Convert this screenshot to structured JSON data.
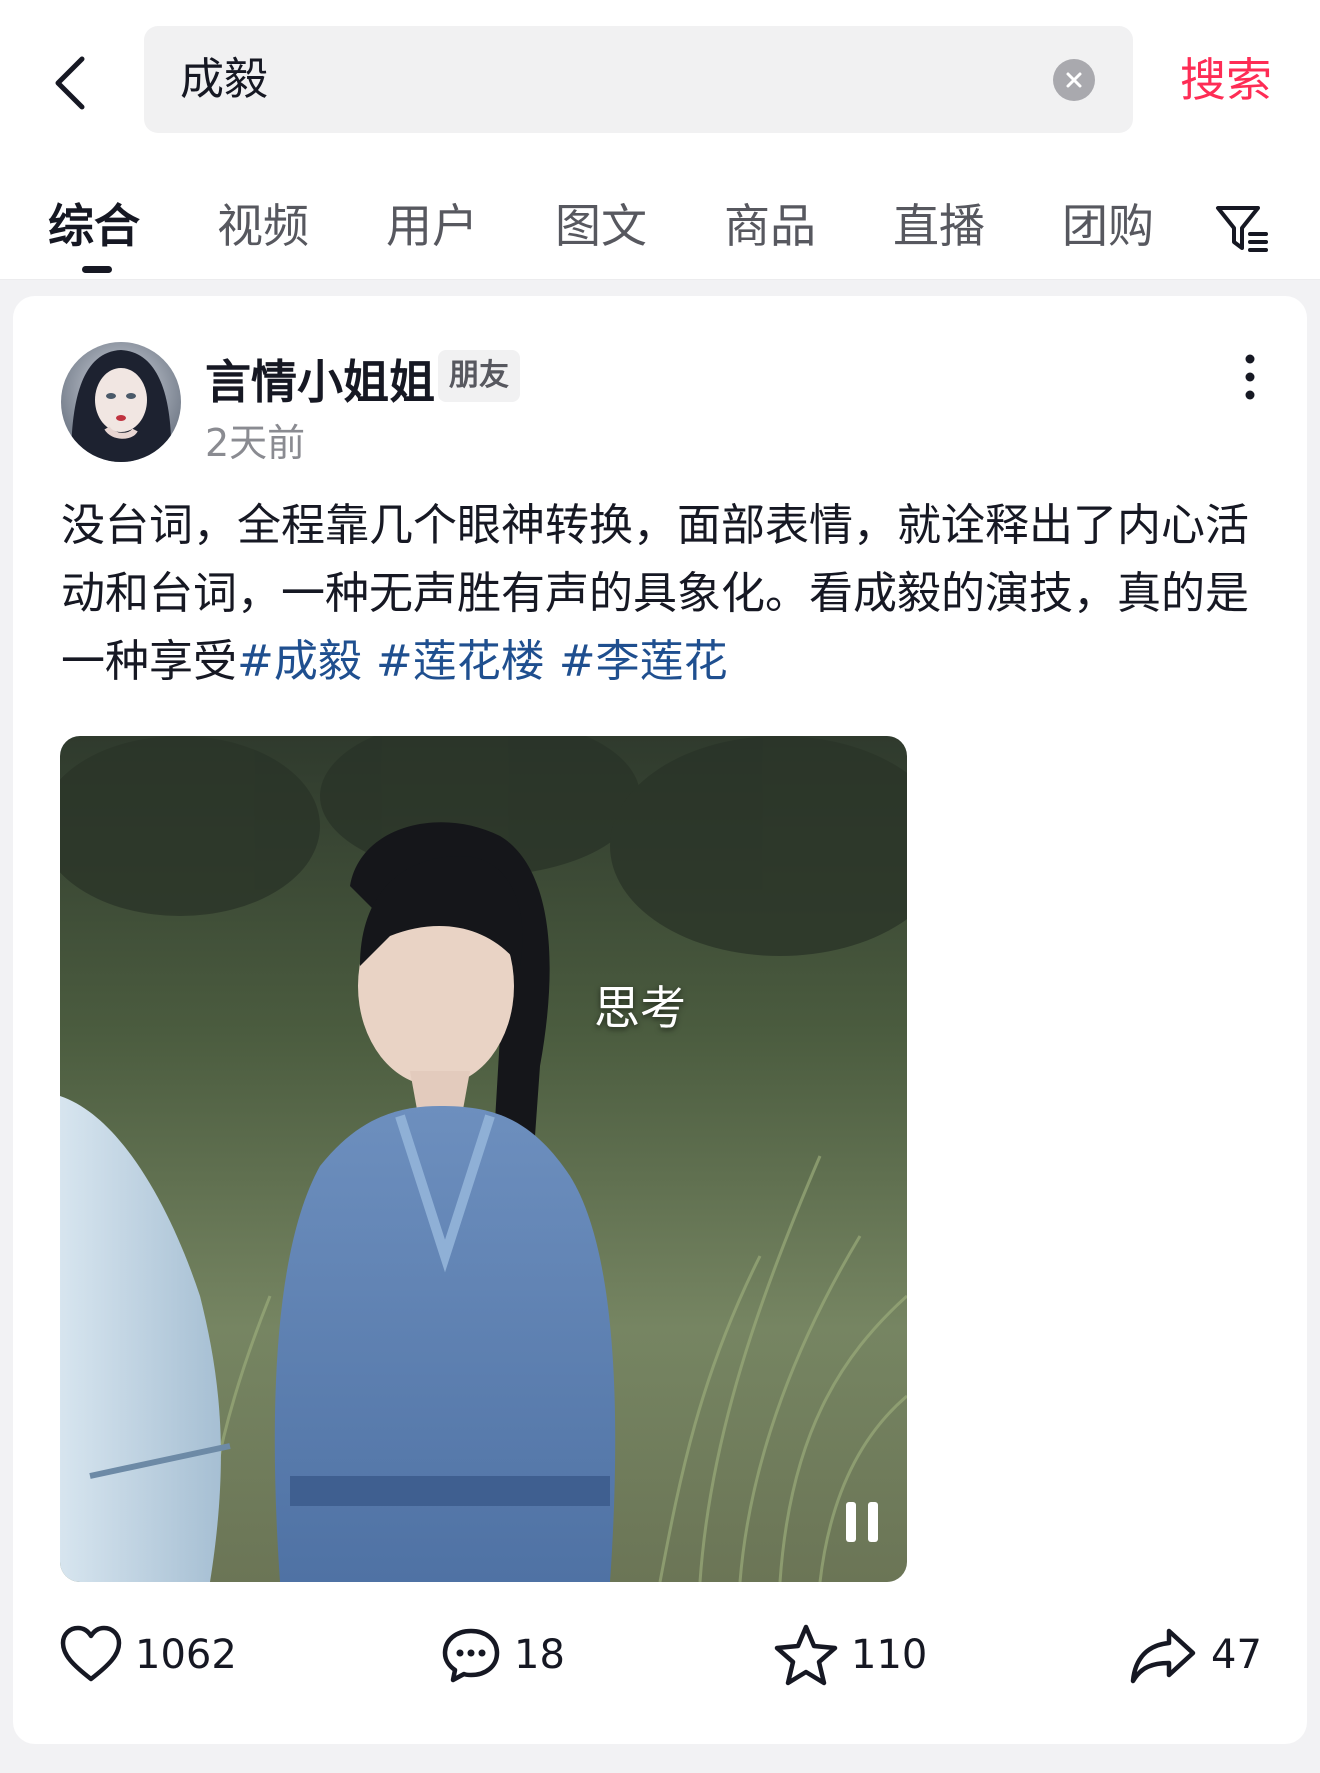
{
  "search": {
    "query": "成毅",
    "submit_label": "搜索"
  },
  "tabs": [
    {
      "label": "综合",
      "active": true
    },
    {
      "label": "视频"
    },
    {
      "label": "用户"
    },
    {
      "label": "图文"
    },
    {
      "label": "商品"
    },
    {
      "label": "直播"
    },
    {
      "label": "团购"
    }
  ],
  "post": {
    "author": "言情小姐姐",
    "badge": "朋友",
    "time": "2天前",
    "text": "没台词，全程靠几个眼神转换，面部表情，就诠释出了内心活动和台词，一种无声胜有声的具象化。看成毅的演技，真的是一种享受",
    "hashtags": [
      "#成毅",
      "#莲花楼",
      "#李莲花"
    ],
    "video_caption": "思考",
    "likes": "1062",
    "comments": "18",
    "favorites": "110",
    "shares": "47"
  },
  "colors": {
    "accent": "#fe2c55",
    "hashtag": "#1f4f8f",
    "text": "#161823",
    "secondary": "#8a8b91"
  }
}
